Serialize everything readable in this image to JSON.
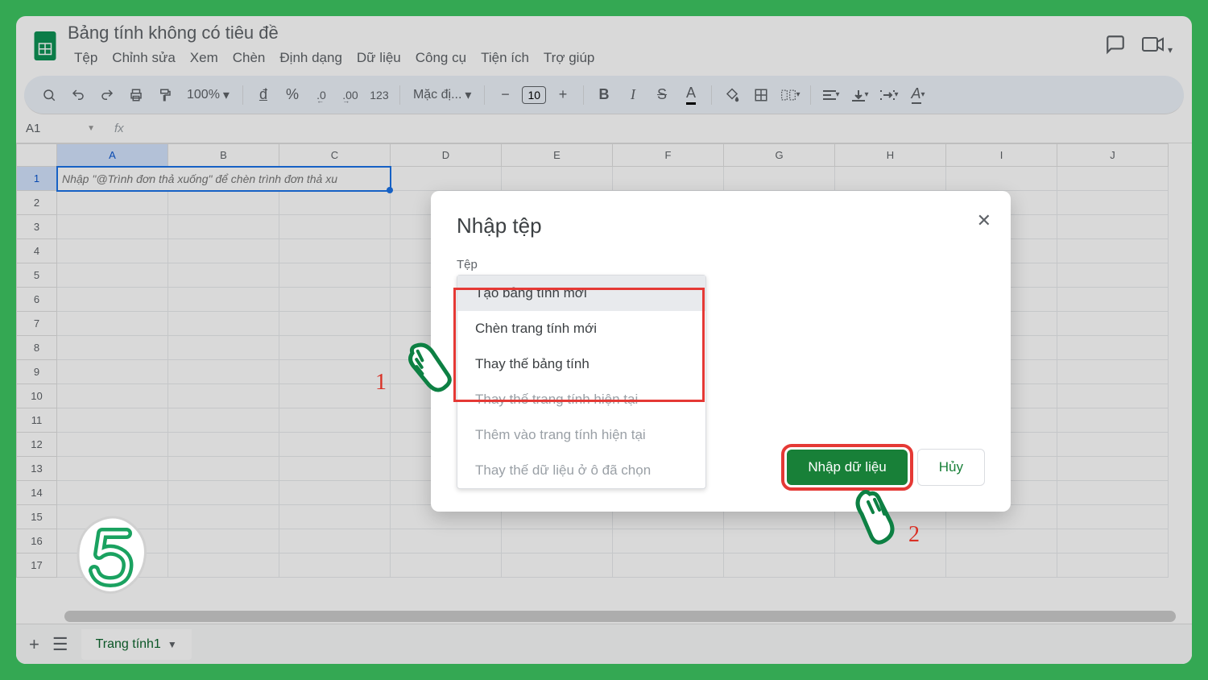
{
  "doc_title": "Bảng tính không có tiêu đề",
  "menubar": [
    "Tệp",
    "Chỉnh sửa",
    "Xem",
    "Chèn",
    "Định dạng",
    "Dữ liệu",
    "Công cụ",
    "Tiện ích",
    "Trợ giúp"
  ],
  "toolbar": {
    "zoom": "100%",
    "font": "Mặc đị...",
    "font_size": "10",
    "currency": "đ",
    "percent": "%",
    "dec_dec": ".0",
    "dec_inc": ".00",
    "num_fmt": "123"
  },
  "namebox": "A1",
  "fx": "fx",
  "columns": [
    "A",
    "B",
    "C",
    "D",
    "E",
    "F",
    "G",
    "H",
    "I",
    "J"
  ],
  "rows": [
    "1",
    "2",
    "3",
    "4",
    "5",
    "6",
    "7",
    "8",
    "9",
    "10",
    "11",
    "12",
    "13",
    "14",
    "15",
    "16",
    "17"
  ],
  "a1_placeholder": "Nhập \"@Trình đơn thả xuống\" để chèn trình đơn thả xu",
  "sheet_tab": "Trang tính1",
  "dialog": {
    "title": "Nhập tệp",
    "field_label": "Tệp",
    "options": [
      {
        "label": "Tạo bảng tính mới",
        "disabled": false,
        "selected": true
      },
      {
        "label": "Chèn trang tính mới",
        "disabled": false,
        "selected": false
      },
      {
        "label": "Thay thế bảng tính",
        "disabled": false,
        "selected": false
      },
      {
        "label": "Thay thế trang tính hiện tại",
        "disabled": true,
        "selected": false
      },
      {
        "label": "Thêm vào trang tính hiện tại",
        "disabled": true,
        "selected": false
      },
      {
        "label": "Thay thế dữ liệu ở ô đã chọn",
        "disabled": true,
        "selected": false
      }
    ],
    "primary": "Nhập dữ liệu",
    "secondary": "Hủy"
  },
  "annotations": {
    "num1": "1",
    "num2": "2"
  }
}
